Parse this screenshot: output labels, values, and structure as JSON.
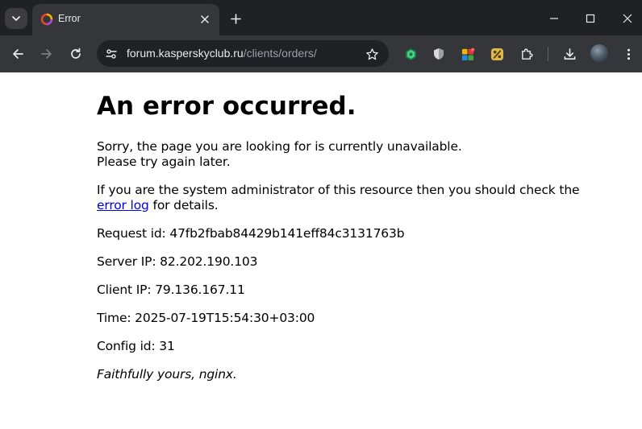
{
  "browser": {
    "tab": {
      "title": "Error"
    },
    "address_bar": {
      "url_host": "forum.kasperskyclub.ru",
      "url_path": "/clients/orders/"
    }
  },
  "page": {
    "heading": "An error occurred.",
    "message_line1": "Sorry, the page you are looking for is currently unavailable.",
    "message_line2": "Please try again later.",
    "admin_text_before": "If you are the system administrator of this resource then you should check the",
    "error_log_link": "error log",
    "admin_text_after": "for details.",
    "request_id": "Request id: 47fb2fbab84429b141eff84c3131763b",
    "server_ip": "Server IP: 82.202.190.103",
    "client_ip": "Client IP: 79.136.167.11",
    "time": "Time: 2025-07-19T15:54:30+03:00",
    "config_id": "Config id: 31",
    "signature": "Faithfully yours, nginx."
  },
  "icons": {
    "tab_search": "chevron-down-icon",
    "favicon": "colorful-ring-icon",
    "extensions": [
      "shield-green-icon",
      "shield-gray-icon",
      "color-blocks-icon",
      "percent-icon",
      "puzzle-icon"
    ],
    "download": "download-icon",
    "menu": "kebab-menu-icon"
  },
  "colors": {
    "chrome_dark": "#202124",
    "chrome_toolbar": "#35363a",
    "link": "#0000ee",
    "text": "#000000"
  }
}
